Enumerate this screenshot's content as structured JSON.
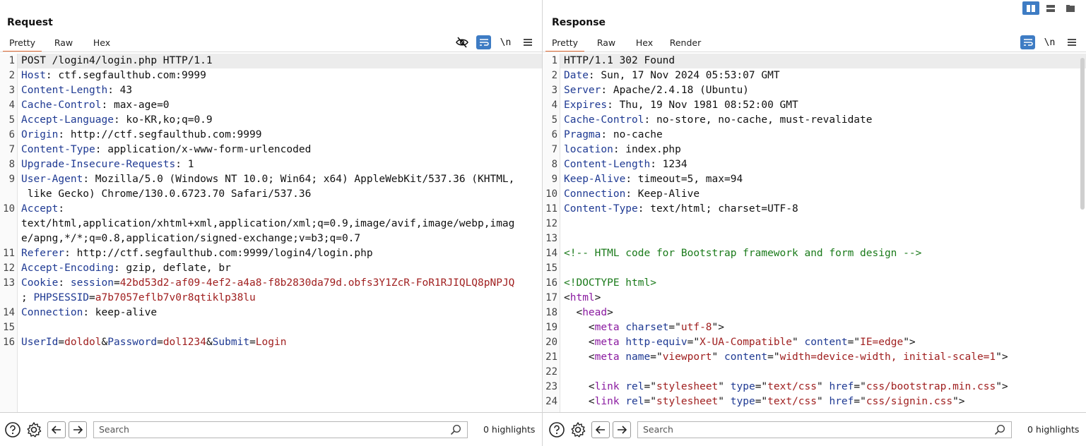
{
  "request": {
    "title": "Request",
    "tabs": [
      "Pretty",
      "Raw",
      "Hex"
    ],
    "active_tab": "Pretty",
    "toolbar_newline_label": "\\n",
    "lines": [
      {
        "n": "1",
        "parts": [
          {
            "t": "POST /login4/login.php HTTP/1.1",
            "c": "v"
          }
        ],
        "hl": true
      },
      {
        "n": "2",
        "parts": [
          {
            "t": "Host",
            "c": "k"
          },
          {
            "t": ": ctf.segfaulthub.com:9999",
            "c": "v"
          }
        ]
      },
      {
        "n": "3",
        "parts": [
          {
            "t": "Content-Length",
            "c": "k"
          },
          {
            "t": ": 43",
            "c": "v"
          }
        ]
      },
      {
        "n": "4",
        "parts": [
          {
            "t": "Cache-Control",
            "c": "k"
          },
          {
            "t": ": max-age=0",
            "c": "v"
          }
        ]
      },
      {
        "n": "5",
        "parts": [
          {
            "t": "Accept-Language",
            "c": "k"
          },
          {
            "t": ": ko-KR,ko;q=0.9",
            "c": "v"
          }
        ]
      },
      {
        "n": "6",
        "parts": [
          {
            "t": "Origin",
            "c": "k"
          },
          {
            "t": ": http://ctf.segfaulthub.com:9999",
            "c": "v"
          }
        ]
      },
      {
        "n": "7",
        "parts": [
          {
            "t": "Content-Type",
            "c": "k"
          },
          {
            "t": ": application/x-www-form-urlencoded",
            "c": "v"
          }
        ]
      },
      {
        "n": "8",
        "parts": [
          {
            "t": "Upgrade-Insecure-Requests",
            "c": "k"
          },
          {
            "t": ": 1",
            "c": "v"
          }
        ]
      },
      {
        "n": "9",
        "parts": [
          {
            "t": "User-Agent",
            "c": "k"
          },
          {
            "t": ": Mozilla/5.0 (Windows NT 10.0; Win64; x64) AppleWebKit/537.36 (KHTML,\n like Gecko) Chrome/130.0.6723.70 Safari/537.36",
            "c": "v"
          }
        ]
      },
      {
        "n": "10",
        "parts": [
          {
            "t": "Accept",
            "c": "k"
          },
          {
            "t": ":\ntext/html,application/xhtml+xml,application/xml;q=0.9,image/avif,image/webp,imag\ne/apng,*/*;q=0.8,application/signed-exchange;v=b3;q=0.7",
            "c": "v"
          }
        ]
      },
      {
        "n": "11",
        "parts": [
          {
            "t": "Referer",
            "c": "k"
          },
          {
            "t": ": http://ctf.segfaulthub.com:9999/login4/login.php",
            "c": "v"
          }
        ]
      },
      {
        "n": "12",
        "parts": [
          {
            "t": "Accept-Encoding",
            "c": "k"
          },
          {
            "t": ": gzip, deflate, br",
            "c": "v"
          }
        ]
      },
      {
        "n": "13",
        "parts": [
          {
            "t": "Cookie",
            "c": "k"
          },
          {
            "t": ": ",
            "c": "v"
          },
          {
            "t": "session",
            "c": "ck"
          },
          {
            "t": "=",
            "c": "v"
          },
          {
            "t": "42bd53d2-af09-4ef2-a4a8-f8b2830da79d.obfs3Y1ZcR-FoR1RJIQLQ8pNPJQ",
            "c": "cv"
          },
          {
            "t": "\n; ",
            "c": "v"
          },
          {
            "t": "PHPSESSID",
            "c": "ck"
          },
          {
            "t": "=",
            "c": "v"
          },
          {
            "t": "a7b7057eflb7v0r8qtiklp38lu",
            "c": "cv"
          }
        ]
      },
      {
        "n": "14",
        "parts": [
          {
            "t": "Connection",
            "c": "k"
          },
          {
            "t": ": keep-alive",
            "c": "v"
          }
        ]
      },
      {
        "n": "15",
        "parts": [
          {
            "t": "",
            "c": "v"
          }
        ]
      },
      {
        "n": "16",
        "parts": [
          {
            "t": "UserId",
            "c": "ck"
          },
          {
            "t": "=",
            "c": "v"
          },
          {
            "t": "doldol",
            "c": "cv"
          },
          {
            "t": "&",
            "c": "v"
          },
          {
            "t": "Password",
            "c": "ck"
          },
          {
            "t": "=",
            "c": "v"
          },
          {
            "t": "dol1234",
            "c": "cv"
          },
          {
            "t": "&",
            "c": "v"
          },
          {
            "t": "Submit",
            "c": "ck"
          },
          {
            "t": "=",
            "c": "v"
          },
          {
            "t": "Login",
            "c": "cv"
          }
        ]
      }
    ],
    "search_placeholder": "Search",
    "highlights": "0 highlights"
  },
  "response": {
    "title": "Response",
    "tabs": [
      "Pretty",
      "Raw",
      "Hex",
      "Render"
    ],
    "active_tab": "Pretty",
    "toolbar_newline_label": "\\n",
    "lines": [
      {
        "n": "1",
        "parts": [
          {
            "t": "HTTP/1.1 302 Found",
            "c": "v"
          }
        ],
        "hl": true
      },
      {
        "n": "2",
        "parts": [
          {
            "t": "Date",
            "c": "k"
          },
          {
            "t": ": Sun, 17 Nov 2024 05:53:07 GMT",
            "c": "v"
          }
        ]
      },
      {
        "n": "3",
        "parts": [
          {
            "t": "Server",
            "c": "k"
          },
          {
            "t": ": Apache/2.4.18 (Ubuntu)",
            "c": "v"
          }
        ]
      },
      {
        "n": "4",
        "parts": [
          {
            "t": "Expires",
            "c": "k"
          },
          {
            "t": ": Thu, 19 Nov 1981 08:52:00 GMT",
            "c": "v"
          }
        ]
      },
      {
        "n": "5",
        "parts": [
          {
            "t": "Cache-Control",
            "c": "k"
          },
          {
            "t": ": no-store, no-cache, must-revalidate",
            "c": "v"
          }
        ]
      },
      {
        "n": "6",
        "parts": [
          {
            "t": "Pragma",
            "c": "k"
          },
          {
            "t": ": no-cache",
            "c": "v"
          }
        ]
      },
      {
        "n": "7",
        "parts": [
          {
            "t": "location",
            "c": "k"
          },
          {
            "t": ": index.php",
            "c": "v"
          }
        ]
      },
      {
        "n": "8",
        "parts": [
          {
            "t": "Content-Length",
            "c": "k"
          },
          {
            "t": ": 1234",
            "c": "v"
          }
        ]
      },
      {
        "n": "9",
        "parts": [
          {
            "t": "Keep-Alive",
            "c": "k"
          },
          {
            "t": ": timeout=5, max=94",
            "c": "v"
          }
        ]
      },
      {
        "n": "10",
        "parts": [
          {
            "t": "Connection",
            "c": "k"
          },
          {
            "t": ": Keep-Alive",
            "c": "v"
          }
        ]
      },
      {
        "n": "11",
        "parts": [
          {
            "t": "Content-Type",
            "c": "k"
          },
          {
            "t": ": text/html; charset=UTF-8",
            "c": "v"
          }
        ]
      },
      {
        "n": "12",
        "parts": [
          {
            "t": "",
            "c": "v"
          }
        ]
      },
      {
        "n": "13",
        "parts": [
          {
            "t": "",
            "c": "v"
          }
        ]
      },
      {
        "n": "14",
        "parts": [
          {
            "t": "<!-- HTML code for Bootstrap framework and form design -->",
            "c": "cm"
          }
        ]
      },
      {
        "n": "15",
        "parts": [
          {
            "t": "",
            "c": "v"
          }
        ]
      },
      {
        "n": "16",
        "parts": [
          {
            "t": "<!DOCTYPE html>",
            "c": "cm"
          }
        ]
      },
      {
        "n": "17",
        "parts": [
          {
            "t": "<",
            "c": "pun"
          },
          {
            "t": "html",
            "c": "tag"
          },
          {
            "t": ">",
            "c": "pun"
          }
        ]
      },
      {
        "n": "18",
        "parts": [
          {
            "t": "  <",
            "c": "pun"
          },
          {
            "t": "head",
            "c": "tag"
          },
          {
            "t": ">",
            "c": "pun"
          }
        ]
      },
      {
        "n": "19",
        "parts": [
          {
            "t": "    <",
            "c": "pun"
          },
          {
            "t": "meta",
            "c": "tag"
          },
          {
            "t": " ",
            "c": "pun"
          },
          {
            "t": "charset",
            "c": "an"
          },
          {
            "t": "=\"",
            "c": "pun"
          },
          {
            "t": "utf-8",
            "c": "av"
          },
          {
            "t": "\">",
            "c": "pun"
          }
        ]
      },
      {
        "n": "20",
        "parts": [
          {
            "t": "    <",
            "c": "pun"
          },
          {
            "t": "meta",
            "c": "tag"
          },
          {
            "t": " ",
            "c": "pun"
          },
          {
            "t": "http-equiv",
            "c": "an"
          },
          {
            "t": "=\"",
            "c": "pun"
          },
          {
            "t": "X-UA-Compatible",
            "c": "av"
          },
          {
            "t": "\" ",
            "c": "pun"
          },
          {
            "t": "content",
            "c": "an"
          },
          {
            "t": "=\"",
            "c": "pun"
          },
          {
            "t": "IE=edge",
            "c": "av"
          },
          {
            "t": "\">",
            "c": "pun"
          }
        ]
      },
      {
        "n": "21",
        "parts": [
          {
            "t": "    <",
            "c": "pun"
          },
          {
            "t": "meta",
            "c": "tag"
          },
          {
            "t": " ",
            "c": "pun"
          },
          {
            "t": "name",
            "c": "an"
          },
          {
            "t": "=\"",
            "c": "pun"
          },
          {
            "t": "viewport",
            "c": "av"
          },
          {
            "t": "\" ",
            "c": "pun"
          },
          {
            "t": "content",
            "c": "an"
          },
          {
            "t": "=\"",
            "c": "pun"
          },
          {
            "t": "width=device-width, initial-scale=1",
            "c": "av"
          },
          {
            "t": "\">",
            "c": "pun"
          }
        ]
      },
      {
        "n": "22",
        "parts": [
          {
            "t": "",
            "c": "v"
          }
        ]
      },
      {
        "n": "23",
        "parts": [
          {
            "t": "    <",
            "c": "pun"
          },
          {
            "t": "link",
            "c": "tag"
          },
          {
            "t": " ",
            "c": "pun"
          },
          {
            "t": "rel",
            "c": "an"
          },
          {
            "t": "=\"",
            "c": "pun"
          },
          {
            "t": "stylesheet",
            "c": "av"
          },
          {
            "t": "\" ",
            "c": "pun"
          },
          {
            "t": "type",
            "c": "an"
          },
          {
            "t": "=\"",
            "c": "pun"
          },
          {
            "t": "text/css",
            "c": "av"
          },
          {
            "t": "\" ",
            "c": "pun"
          },
          {
            "t": "href",
            "c": "an"
          },
          {
            "t": "=\"",
            "c": "pun"
          },
          {
            "t": "css/bootstrap.min.css",
            "c": "av"
          },
          {
            "t": "\">",
            "c": "pun"
          }
        ]
      },
      {
        "n": "24",
        "parts": [
          {
            "t": "    <",
            "c": "pun"
          },
          {
            "t": "link",
            "c": "tag"
          },
          {
            "t": " ",
            "c": "pun"
          },
          {
            "t": "rel",
            "c": "an"
          },
          {
            "t": "=\"",
            "c": "pun"
          },
          {
            "t": "stylesheet",
            "c": "av"
          },
          {
            "t": "\" ",
            "c": "pun"
          },
          {
            "t": "type",
            "c": "an"
          },
          {
            "t": "=\"",
            "c": "pun"
          },
          {
            "t": "text/css",
            "c": "av"
          },
          {
            "t": "\" ",
            "c": "pun"
          },
          {
            "t": "href",
            "c": "an"
          },
          {
            "t": "=\"",
            "c": "pun"
          },
          {
            "t": "css/signin.css",
            "c": "av"
          },
          {
            "t": "\">",
            "c": "pun"
          }
        ]
      }
    ],
    "search_placeholder": "Search",
    "highlights": "0 highlights"
  },
  "icons": {
    "hide": "eye-slash-icon",
    "wrap": "word-wrap-icon",
    "menu": "hamburger-menu-icon",
    "help": "help-icon",
    "settings": "gear-icon",
    "back": "arrow-left-icon",
    "forward": "arrow-right-icon",
    "search": "search-icon",
    "layout_split": "split-vertical-layout-icon",
    "layout_horizontal": "split-horizontal-layout-icon",
    "layout_tabs": "tabs-layout-icon"
  },
  "colors": {
    "accent_tab": "#e8703a",
    "toolbar_blue": "#3e7cc4",
    "header_key": "#1f3a93",
    "value_red": "#a02020",
    "comment_green": "#1a7a1a",
    "tag_purple": "#8a1aa0"
  }
}
